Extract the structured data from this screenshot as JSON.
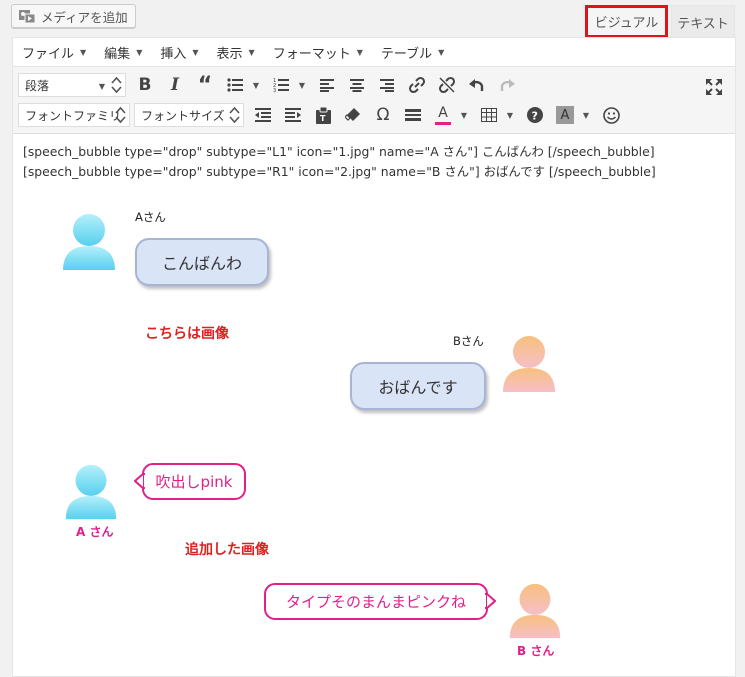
{
  "media_button": {
    "label": "メディアを追加"
  },
  "tabs": {
    "visual": "ビジュアル",
    "text": "テキスト"
  },
  "menubar": [
    "ファイル",
    "編集",
    "挿入",
    "表示",
    "フォーマット",
    "テーブル"
  ],
  "toolbar": {
    "format_select": "段落",
    "font_family": "フォントファミリ",
    "font_size": "フォントサイズ"
  },
  "shortcode_lines": [
    "[speech_bubble type=\"drop\" subtype=\"L1\" icon=\"1.jpg\" name=\"A さん\"] こんばんわ [/speech_bubble]",
    "[speech_bubble type=\"drop\" subtype=\"R1\" icon=\"2.jpg\" name=\"B さん\"] おばんです [/speech_bubble]"
  ],
  "bubbles": {
    "a1": {
      "name": "Aさん",
      "text": "こんばんわ"
    },
    "b1": {
      "name": "Bさん",
      "text": "おばんです"
    },
    "a2": {
      "name": "A さん",
      "text": "吹出しpink"
    },
    "b2": {
      "name": "B さん",
      "text": "タイプそのまんまピンクね"
    }
  },
  "annotations": {
    "image": "こちらは画像",
    "added_image": "追加した画像"
  },
  "colors": {
    "highlight": "#e0121c",
    "pink": "#e0218a",
    "bubble_fill": "#dae4f7",
    "red_text": "#e02020"
  }
}
